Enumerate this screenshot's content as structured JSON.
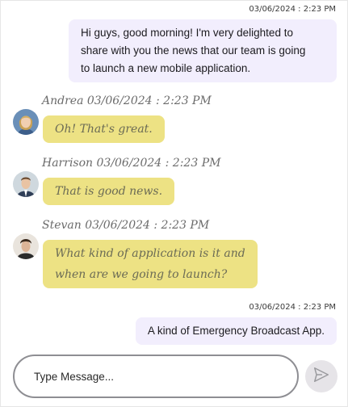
{
  "messages": [
    {
      "direction": "outgoing",
      "timestamp": "03/06/2024 : 2:23 PM",
      "lines": [
        "Hi guys, good morning! I'm very delighted to",
        "share with you the news that our team is going",
        "to launch a new mobile application."
      ]
    },
    {
      "direction": "incoming",
      "author": "Andrea",
      "timestamp": "03/06/2024 : 2:23 PM",
      "header": "Andrea 03/06/2024 : 2:23 PM",
      "lines": [
        "Oh! That's great."
      ]
    },
    {
      "direction": "incoming",
      "author": "Harrison",
      "timestamp": "03/06/2024 : 2:23 PM",
      "header": "Harrison 03/06/2024 : 2:23 PM",
      "lines": [
        "That is good news."
      ]
    },
    {
      "direction": "incoming",
      "author": "Stevan",
      "timestamp": "03/06/2024 : 2:23 PM",
      "header": "Stevan 03/06/2024 : 2:23 PM",
      "lines": [
        "What kind of application is it and",
        "when are we going to launch?"
      ]
    },
    {
      "direction": "outgoing",
      "timestamp": "03/06/2024 : 2:23 PM",
      "lines": [
        "A kind of Emergency Broadcast App."
      ]
    }
  ],
  "composer": {
    "value": "",
    "placeholder": "Type Message..."
  },
  "icons": {
    "send": "send-icon"
  },
  "colors": {
    "outgoing_bubble": "#f2eefd",
    "incoming_bubble": "#ede284",
    "send_button_bg": "#e6e4e8",
    "composer_border": "#8e8e93"
  }
}
